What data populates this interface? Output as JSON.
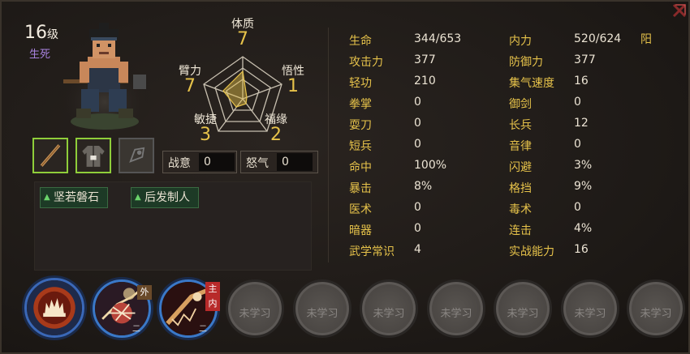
{
  "character": {
    "level_number": "16",
    "level_suffix": "级",
    "title": "生死"
  },
  "attributes": {
    "constitution": {
      "name": "体质",
      "value": "7"
    },
    "comprehension": {
      "name": "悟性",
      "value": "1"
    },
    "fortune": {
      "name": "福缘",
      "value": "2"
    },
    "agility": {
      "name": "敏捷",
      "value": "3"
    },
    "strength": {
      "name": "臂力",
      "value": "7"
    }
  },
  "gauges": {
    "battle_intent": {
      "label": "战意",
      "value": "0"
    },
    "rage": {
      "label": "怒气",
      "value": "0"
    }
  },
  "traits": [
    "坚若磐石",
    "后发制人"
  ],
  "stats_left": [
    {
      "k": "生命",
      "v": "344/653"
    },
    {
      "k": "攻击力",
      "v": "377"
    },
    {
      "k": "轻功",
      "v": "210"
    },
    {
      "k": "拳掌",
      "v": "0"
    },
    {
      "k": "耍刀",
      "v": "0"
    },
    {
      "k": "短兵",
      "v": "0"
    },
    {
      "k": "命中",
      "v": "100%"
    },
    {
      "k": "暴击",
      "v": "8%"
    },
    {
      "k": "医术",
      "v": "0"
    },
    {
      "k": "暗器",
      "v": "0"
    },
    {
      "k": "武学常识",
      "v": "4"
    }
  ],
  "stats_right": [
    {
      "k": "内力",
      "v": "520/624"
    },
    {
      "k": "防御力",
      "v": "377"
    },
    {
      "k": "集气速度",
      "v": "16"
    },
    {
      "k": "御剑",
      "v": "0"
    },
    {
      "k": "长兵",
      "v": "12"
    },
    {
      "k": "音律",
      "v": "0"
    },
    {
      "k": "闪避",
      "v": "3%"
    },
    {
      "k": "格挡",
      "v": "9%"
    },
    {
      "k": "毒术",
      "v": "0"
    },
    {
      "k": "连击",
      "v": "4%"
    },
    {
      "k": "实战能力",
      "v": "16"
    }
  ],
  "yin_yang": "阳",
  "skills": {
    "skill2_tag": "外",
    "skill3_tag_top": "主",
    "skill3_tag_bottom": "内",
    "skill2_level": "二",
    "skill3_level": "二",
    "locked_label": "未学习",
    "locked_count": 7
  },
  "colors": {
    "accent": "#e6c24a",
    "title_purple": "#a983e0",
    "trait_green": "#1d3a26",
    "slot_border": "#8fce3a",
    "skill_ring": "#3a78c8"
  }
}
